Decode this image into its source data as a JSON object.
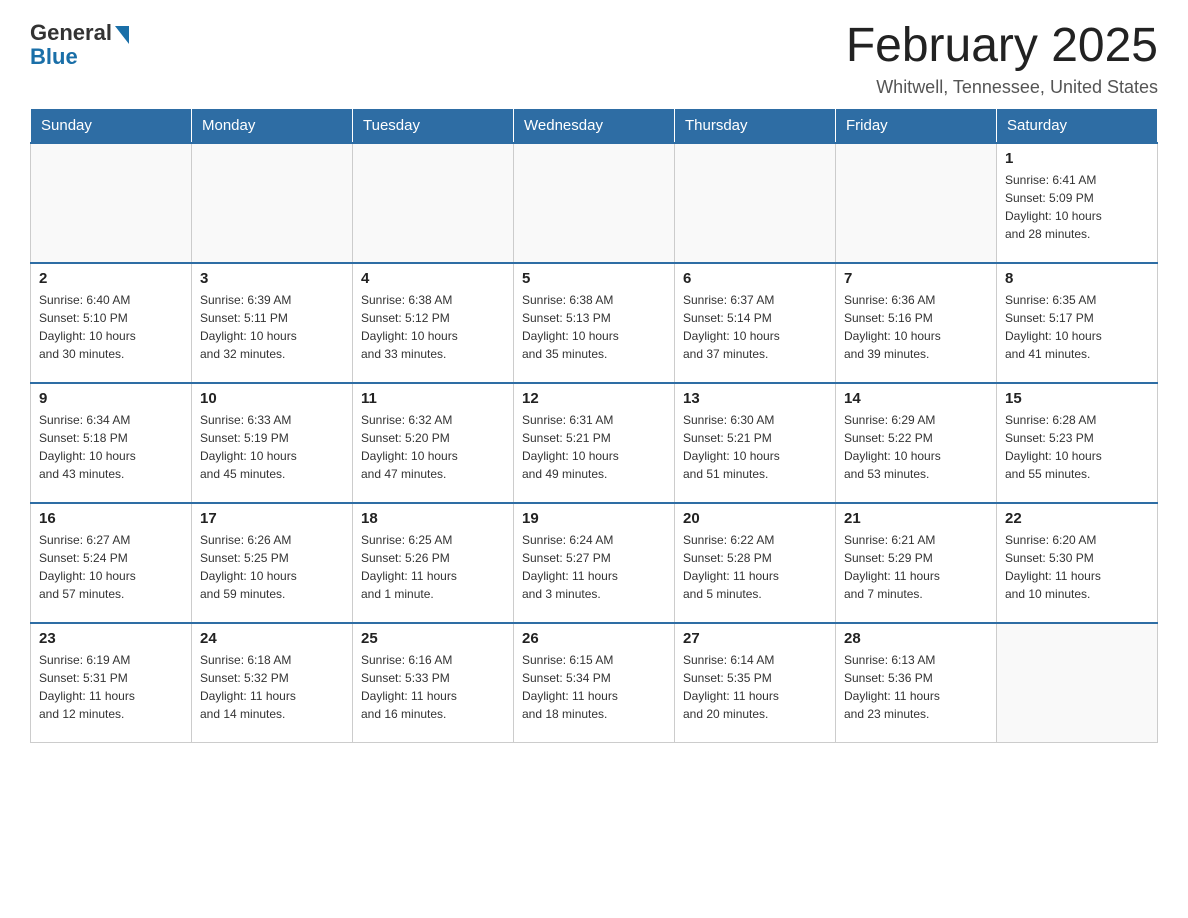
{
  "header": {
    "logo_general": "General",
    "logo_blue": "Blue",
    "title": "February 2025",
    "location": "Whitwell, Tennessee, United States"
  },
  "days_of_week": [
    "Sunday",
    "Monday",
    "Tuesday",
    "Wednesday",
    "Thursday",
    "Friday",
    "Saturday"
  ],
  "weeks": [
    [
      {
        "day": "",
        "info": ""
      },
      {
        "day": "",
        "info": ""
      },
      {
        "day": "",
        "info": ""
      },
      {
        "day": "",
        "info": ""
      },
      {
        "day": "",
        "info": ""
      },
      {
        "day": "",
        "info": ""
      },
      {
        "day": "1",
        "info": "Sunrise: 6:41 AM\nSunset: 5:09 PM\nDaylight: 10 hours\nand 28 minutes."
      }
    ],
    [
      {
        "day": "2",
        "info": "Sunrise: 6:40 AM\nSunset: 5:10 PM\nDaylight: 10 hours\nand 30 minutes."
      },
      {
        "day": "3",
        "info": "Sunrise: 6:39 AM\nSunset: 5:11 PM\nDaylight: 10 hours\nand 32 minutes."
      },
      {
        "day": "4",
        "info": "Sunrise: 6:38 AM\nSunset: 5:12 PM\nDaylight: 10 hours\nand 33 minutes."
      },
      {
        "day": "5",
        "info": "Sunrise: 6:38 AM\nSunset: 5:13 PM\nDaylight: 10 hours\nand 35 minutes."
      },
      {
        "day": "6",
        "info": "Sunrise: 6:37 AM\nSunset: 5:14 PM\nDaylight: 10 hours\nand 37 minutes."
      },
      {
        "day": "7",
        "info": "Sunrise: 6:36 AM\nSunset: 5:16 PM\nDaylight: 10 hours\nand 39 minutes."
      },
      {
        "day": "8",
        "info": "Sunrise: 6:35 AM\nSunset: 5:17 PM\nDaylight: 10 hours\nand 41 minutes."
      }
    ],
    [
      {
        "day": "9",
        "info": "Sunrise: 6:34 AM\nSunset: 5:18 PM\nDaylight: 10 hours\nand 43 minutes."
      },
      {
        "day": "10",
        "info": "Sunrise: 6:33 AM\nSunset: 5:19 PM\nDaylight: 10 hours\nand 45 minutes."
      },
      {
        "day": "11",
        "info": "Sunrise: 6:32 AM\nSunset: 5:20 PM\nDaylight: 10 hours\nand 47 minutes."
      },
      {
        "day": "12",
        "info": "Sunrise: 6:31 AM\nSunset: 5:21 PM\nDaylight: 10 hours\nand 49 minutes."
      },
      {
        "day": "13",
        "info": "Sunrise: 6:30 AM\nSunset: 5:21 PM\nDaylight: 10 hours\nand 51 minutes."
      },
      {
        "day": "14",
        "info": "Sunrise: 6:29 AM\nSunset: 5:22 PM\nDaylight: 10 hours\nand 53 minutes."
      },
      {
        "day": "15",
        "info": "Sunrise: 6:28 AM\nSunset: 5:23 PM\nDaylight: 10 hours\nand 55 minutes."
      }
    ],
    [
      {
        "day": "16",
        "info": "Sunrise: 6:27 AM\nSunset: 5:24 PM\nDaylight: 10 hours\nand 57 minutes."
      },
      {
        "day": "17",
        "info": "Sunrise: 6:26 AM\nSunset: 5:25 PM\nDaylight: 10 hours\nand 59 minutes."
      },
      {
        "day": "18",
        "info": "Sunrise: 6:25 AM\nSunset: 5:26 PM\nDaylight: 11 hours\nand 1 minute."
      },
      {
        "day": "19",
        "info": "Sunrise: 6:24 AM\nSunset: 5:27 PM\nDaylight: 11 hours\nand 3 minutes."
      },
      {
        "day": "20",
        "info": "Sunrise: 6:22 AM\nSunset: 5:28 PM\nDaylight: 11 hours\nand 5 minutes."
      },
      {
        "day": "21",
        "info": "Sunrise: 6:21 AM\nSunset: 5:29 PM\nDaylight: 11 hours\nand 7 minutes."
      },
      {
        "day": "22",
        "info": "Sunrise: 6:20 AM\nSunset: 5:30 PM\nDaylight: 11 hours\nand 10 minutes."
      }
    ],
    [
      {
        "day": "23",
        "info": "Sunrise: 6:19 AM\nSunset: 5:31 PM\nDaylight: 11 hours\nand 12 minutes."
      },
      {
        "day": "24",
        "info": "Sunrise: 6:18 AM\nSunset: 5:32 PM\nDaylight: 11 hours\nand 14 minutes."
      },
      {
        "day": "25",
        "info": "Sunrise: 6:16 AM\nSunset: 5:33 PM\nDaylight: 11 hours\nand 16 minutes."
      },
      {
        "day": "26",
        "info": "Sunrise: 6:15 AM\nSunset: 5:34 PM\nDaylight: 11 hours\nand 18 minutes."
      },
      {
        "day": "27",
        "info": "Sunrise: 6:14 AM\nSunset: 5:35 PM\nDaylight: 11 hours\nand 20 minutes."
      },
      {
        "day": "28",
        "info": "Sunrise: 6:13 AM\nSunset: 5:36 PM\nDaylight: 11 hours\nand 23 minutes."
      },
      {
        "day": "",
        "info": ""
      }
    ]
  ]
}
